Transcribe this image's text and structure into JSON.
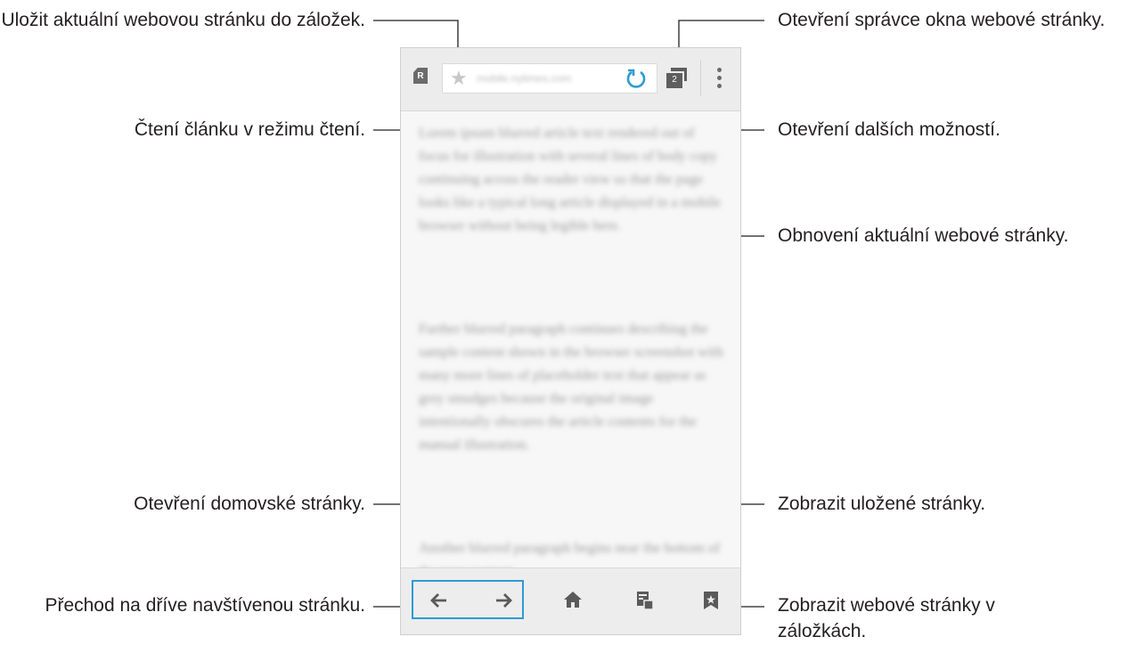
{
  "callouts": {
    "bookmark_save": "Uložit aktuální webovou stránku do záložek.",
    "reader_mode": "Čtení článku v režimu čtení.",
    "window_manager": "Otevření správce okna webové stránky.",
    "more_options": "Otevření dalších možností.",
    "refresh": "Obnovení aktuální webové stránky.",
    "home": "Otevření domovské stránky.",
    "saved_pages": "Zobrazit uložené stránky.",
    "navigate": "Přechod na dříve navštívenou stránku.",
    "bookmarks_view": "Zobrazit webové stránky v záložkách."
  },
  "browser": {
    "reader_label": "R",
    "url": "mobile.nytimes.com",
    "tab_count": "2",
    "paragraphs": [
      "Lorem ipsum blurred article text rendered out of focus for illustration with several lines of body copy continuing across the reader view so that the page looks like a typical long article displayed in a mobile browser without being legible here.",
      "Further blurred paragraph continues describing the sample content shown in the browser screenshot with many more lines of placeholder text that appear as grey smudges because the original image intentionally obscures the article contents for the manual illustration.",
      "Another blurred paragraph begins near the bottom of the page content."
    ]
  },
  "icons": {
    "accent": "#2e9bd3",
    "icon_gray": "#5a5a5a"
  }
}
